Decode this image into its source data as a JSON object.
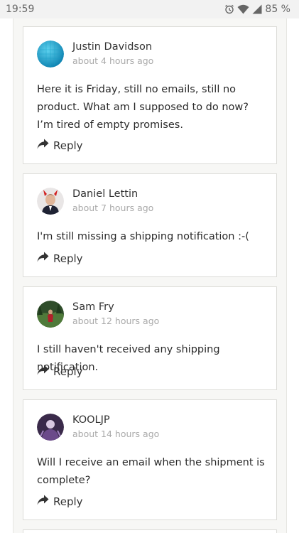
{
  "status_bar": {
    "time": "19:59",
    "battery": "85 %",
    "icons": [
      "alarm-icon",
      "wifi-icon",
      "signal-icon"
    ]
  },
  "comments": [
    {
      "author": "Justin Davidson",
      "time": "about 4 hours ago",
      "text": "Here it is Friday, still no emails, still no product. What am I supposed to do now? I’m tired of empty promises.",
      "reply": "Reply",
      "avatar": "teal-sphere-avatar"
    },
    {
      "author": "Daniel Lettin",
      "time": "about 7 hours ago",
      "text": "I'm still missing a shipping notification :-(",
      "reply": "Reply",
      "avatar": "devil-horns-avatar"
    },
    {
      "author": "Sam Fry",
      "time": "about 12 hours ago",
      "text": "I still haven't received any shipping notification.",
      "reply": "Reply",
      "avatar": "forest-avatar"
    },
    {
      "author": "KOOLJP",
      "time": "about 14 hours ago",
      "text": "Will I receive an email when the shipment is complete?",
      "reply": "Reply",
      "avatar": "character-avatar"
    }
  ],
  "colors": {
    "feed_background": "#f7f7f5",
    "card_border": "#dcdcd8",
    "muted_text": "#aaaaaa"
  }
}
